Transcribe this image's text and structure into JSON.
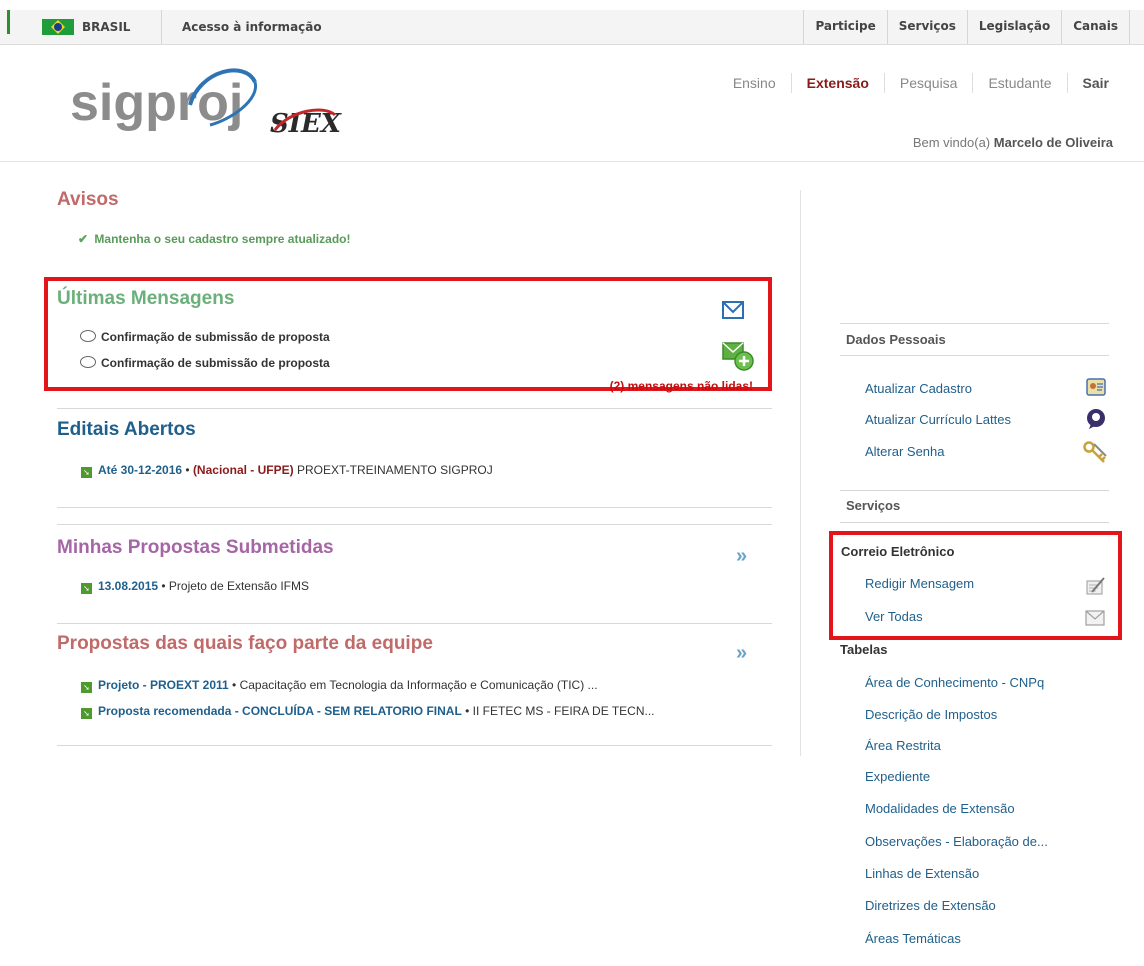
{
  "gov_bar": {
    "country": "BRASIL",
    "access": "Acesso à informação",
    "links": [
      "Participe",
      "Serviços",
      "Legislação",
      "Canais"
    ],
    "flag_colors": {
      "green": "#1f9d3b",
      "yellow": "#f4d12b",
      "blue": "#1b3c8c"
    }
  },
  "header": {
    "logo_text": "sigproj",
    "logo_sub": "SIEX",
    "nav": [
      "Ensino",
      "Extensão",
      "Pesquisa",
      "Estudante",
      "Sair"
    ],
    "active_nav": "Extensão",
    "welcome_prefix": "Bem vindo(a)",
    "user_name": "Marcelo de Oliveira"
  },
  "avisos": {
    "title": "Avisos",
    "notice": "Mantenha o seu cadastro sempre atualizado!"
  },
  "messages": {
    "title": "Últimas Mensagens",
    "items": [
      "Confirmação de submissão de proposta",
      "Confirmação de submissão de proposta"
    ],
    "unread": "(2) mensagens não lidas!",
    "icons": [
      "mail-icon",
      "new-mail-icon"
    ]
  },
  "editais": {
    "title": "Editais Abertos",
    "item": {
      "date": "Até 30-12-2016",
      "sep": " • ",
      "scope": "(Nacional - UFPE)",
      "name": " PROEXT-TREINAMENTO SIGPROJ"
    }
  },
  "propostas": {
    "title": "Minhas Propostas Submetidas",
    "item": {
      "date": "13.08.2015",
      "text": " • Projeto de Extensão IFMS"
    }
  },
  "equipe": {
    "title": "Propostas das quais faço parte da equipe",
    "items": [
      {
        "hl": "Projeto - PROEXT 2011",
        "text": " • Capacitação em Tecnologia da Informação e Comunicação (TIC) ..."
      },
      {
        "hl": "Proposta recomendada - CONCLUÍDA - SEM RELATORIO FINAL",
        "text": " • II FETEC MS - FEIRA DE TECN..."
      }
    ]
  },
  "sidebar": {
    "dados_title": "Dados Pessoais",
    "dados_links": [
      "Atualizar Cadastro",
      "Atualizar Currículo Lattes",
      "Alterar Senha"
    ],
    "servicos_title": "Serviços",
    "correio_title": "Correio Eletrônico",
    "correio_links": [
      "Redigir Mensagem",
      "Ver Todas"
    ],
    "tabelas_title": "Tabelas",
    "tabelas_links": [
      "Área de Conhecimento - CNPq",
      "Descrição de Impostos",
      "Área Restrita",
      "Expediente",
      "Modalidades de Extensão",
      "Observações - Elaboração de...",
      "Linhas de Extensão",
      "Diretrizes de Extensão",
      "Áreas Temáticas"
    ]
  },
  "colors": {
    "highlight_border": "#e2151b",
    "link_blue": "#1f5f8b",
    "active_red": "#8b1a1a"
  }
}
